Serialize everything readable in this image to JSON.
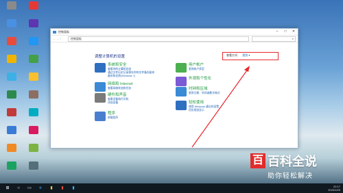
{
  "desktop": {
    "icons": [
      {
        "label": "",
        "color": "#8a8a8a"
      },
      {
        "label": "",
        "color": "#4a90e2"
      },
      {
        "label": "",
        "color": "#e84c3d"
      },
      {
        "label": "",
        "color": "#f0b400"
      },
      {
        "label": "",
        "color": "#3db0e6"
      },
      {
        "label": "",
        "color": "#2d8a4e"
      },
      {
        "label": "",
        "color": "#c23b3b"
      },
      {
        "label": "",
        "color": "#3a7bd5"
      },
      {
        "label": "",
        "color": "#f08a24"
      },
      {
        "label": "",
        "color": "#1aa260"
      },
      {
        "label": "",
        "color": "#e53935"
      },
      {
        "label": "",
        "color": "#5e35b1"
      },
      {
        "label": "",
        "color": "#2196f3"
      },
      {
        "label": "",
        "color": "#43a047"
      },
      {
        "label": "",
        "color": "#fbc02d"
      },
      {
        "label": "",
        "color": "#8d6e63"
      },
      {
        "label": "",
        "color": "#00acc1"
      },
      {
        "label": "",
        "color": "#d81b60"
      },
      {
        "label": "",
        "color": "#7cb342"
      },
      {
        "label": "",
        "color": "#546e7a"
      }
    ]
  },
  "window": {
    "title": "控制面板",
    "address": "控制面板",
    "heading": "调整计算机的设置",
    "view_by_label": "查看方式:",
    "view_by_value": "类别 ▾",
    "categories_left": [
      {
        "title": "系统和安全",
        "subs": [
          "查看你的计算机状态",
          "通过文件历史记录保存你的文件备份副本",
          "备份和还原(Windows 7)"
        ],
        "color": "#2f6fc0"
      },
      {
        "title": "网络和 Internet",
        "subs": [
          "查看网络状态和任务"
        ],
        "color": "#3a8ad6"
      },
      {
        "title": "硬件和声音",
        "subs": [
          "查看设备和打印机",
          "添加设备"
        ],
        "color": "#7a7a7a"
      },
      {
        "title": "程序",
        "subs": [
          "卸载程序"
        ],
        "color": "#4a7fcf"
      }
    ],
    "categories_right": [
      {
        "title": "用户帐户",
        "subs": [
          "更改帐户类型"
        ],
        "color": "#4caf50"
      },
      {
        "title": "外观和个性化",
        "subs": [],
        "color": "#7b5ad6"
      },
      {
        "title": "时钟和区域",
        "subs": [
          "更改日期、时间或数字格式"
        ],
        "color": "#3a8ad6"
      },
      {
        "title": "轻松使用",
        "subs": [
          "使用 Windows 建议的设置",
          "优化视觉显示"
        ],
        "color": "#2f6fc0"
      }
    ]
  },
  "taskbar": {
    "start": "⊞",
    "time": "22:17",
    "date": "2020/2/29"
  },
  "watermark": {
    "brand": "百科全说",
    "sub": "助你轻松解决",
    "mark": "百"
  }
}
